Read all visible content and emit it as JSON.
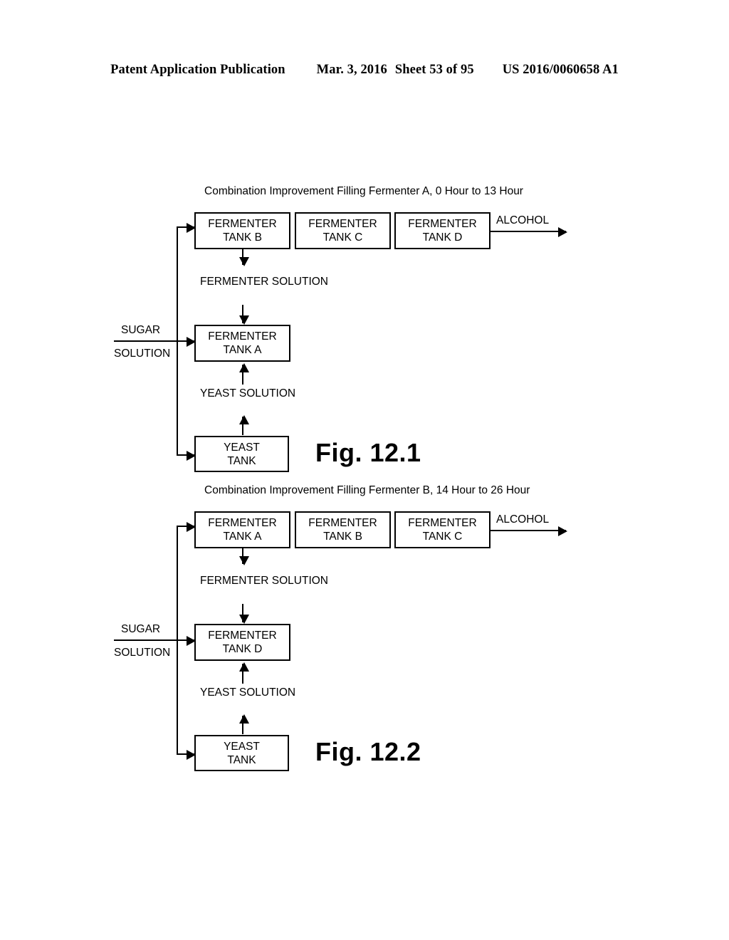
{
  "header": {
    "publication": "Patent Application Publication",
    "date": "Mar. 3, 2016",
    "sheet": "Sheet 53 of 95",
    "document_number": "US 2016/0060658 A1"
  },
  "figures": [
    {
      "id": "fig-12-1",
      "title": "Combination Improvement Filling Fermenter A, 0 Hour to 13 Hour",
      "caption": "Fig. 12.1",
      "top_tanks": [
        {
          "line1": "FERMENTER",
          "line2": "TANK B"
        },
        {
          "line1": "FERMENTER",
          "line2": "TANK C"
        },
        {
          "line1": "FERMENTER",
          "line2": "TANK D"
        }
      ],
      "middle_tank": {
        "line1": "FERMENTER",
        "line2": "TANK A"
      },
      "yeast_tank": {
        "line1": "YEAST",
        "line2": "TANK"
      },
      "labels": {
        "fermenter_solution_line1": "FERMENTER",
        "fermenter_solution_line2": "SOLUTION",
        "yeast_solution_line1": "YEAST",
        "yeast_solution_line2": "SOLUTION",
        "alcohol": "ALCOHOL",
        "sugar": "SUGAR",
        "solution": "SOLUTION"
      }
    },
    {
      "id": "fig-12-2",
      "title": "Combination Improvement Filling Fermenter B, 14 Hour to 26 Hour",
      "caption": "Fig. 12.2",
      "top_tanks": [
        {
          "line1": "FERMENTER",
          "line2": "TANK A"
        },
        {
          "line1": "FERMENTER",
          "line2": "TANK B"
        },
        {
          "line1": "FERMENTER",
          "line2": "TANK C"
        }
      ],
      "middle_tank": {
        "line1": "FERMENTER",
        "line2": "TANK D"
      },
      "yeast_tank": {
        "line1": "YEAST",
        "line2": "TANK"
      },
      "labels": {
        "fermenter_solution_line1": "FERMENTER",
        "fermenter_solution_line2": "SOLUTION",
        "yeast_solution_line1": "YEAST",
        "yeast_solution_line2": "SOLUTION",
        "alcohol": "ALCOHOL",
        "sugar": "SUGAR",
        "solution": "SOLUTION"
      }
    }
  ],
  "colors": {
    "ink": "#000000",
    "paper": "#ffffff"
  }
}
